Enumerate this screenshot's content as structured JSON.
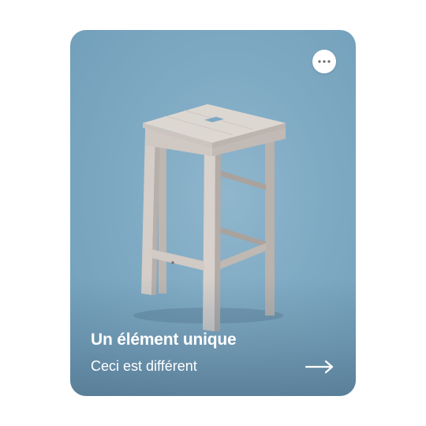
{
  "card": {
    "image_alt": "stool-photo",
    "title": "Un élément unique",
    "subtitle": "Ceci est différent",
    "more_icon": "more-horizontal-icon",
    "arrow_icon": "arrow-right-icon",
    "text_color": "#ffffff",
    "background_color": "#7faac3"
  }
}
